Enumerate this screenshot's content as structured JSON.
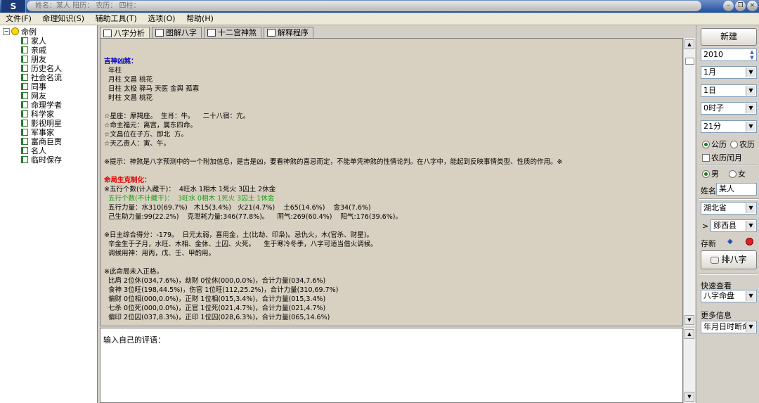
{
  "window": {
    "title": "姓名：某人   阳历：  农历：  四柱：",
    "icon_label": "S"
  },
  "menu": [
    "文件(F)",
    "命理知识(S)",
    "辅助工具(T)",
    "选项(O)",
    "帮助(H)"
  ],
  "tree": {
    "root_label": "命例",
    "items": [
      "家人",
      "亲戚",
      "朋友",
      "历史名人",
      "社会名流",
      "同事",
      "网友",
      "命理学者",
      "科学家",
      "影视明星",
      "军事家",
      "富商巨贾",
      "名人",
      "临时保存"
    ]
  },
  "tabs": [
    "八字分析",
    "图解八字",
    "十二宫神煞",
    "解释程序"
  ],
  "analysis": {
    "shensha_title": "吉神凶煞：",
    "shensha_lines": [
      "  年柱",
      "  月柱 文昌 桃花",
      "  日柱 太极 驿马 天医 金舆 孤寡",
      "  时柱 文昌 桃花"
    ],
    "star_lines": [
      "☆星座：摩羯座。  生肖：牛。    二十八宿：亢。",
      "☆命主福元：离宫，属东四命。",
      "☆文昌位在子方、即北  方。",
      "☆天乙贵人：寅、午。"
    ],
    "note": "※提示：神煞是八字预测中的一个附加信息，是吉是凶，要看神煞的喜忌而定，不能单凭神煞的性情论判。在八字中，能起到反映事情类型、性质的作用。※",
    "wuxing_title": "命局生克制化：",
    "wuxing_line1": "※五行个数(计入藏干)：  4旺水 1相木 1死火 3囚土 2休金",
    "wuxing_line2": "  五行个数(不计藏干)：  3旺水 0相木 1死火 3囚土 1休金",
    "wuxing_lines": [
      "  五行力量：水310(69.7%)   木15(3.4%)   火21(4.7%)    土65(14.6%)    金34(7.6%)",
      "  己生助力量:99(22.2%)    克泄耗力量:346(77.8%)。    阴气:269(60.4%)    阳气:176(39.6%)。"
    ],
    "score_lines": [
      "※日主综合得分：-179。  日元太弱，喜用金，土(比劫、印枭)。忌仇火，木(官杀、财星)。",
      "  辛金生于子月，水旺、木相、金休、土囚、火死。    生于寒冷冬季，八字可适当借火调候。",
      "  调候用神：用丙，戊、壬、甲酌用。"
    ],
    "pattern_lines": [
      "※此命局未入正格。",
      "  比肩 2位休(034,7.6%)，劫财 0位休(000,0.0%)，合计力量(034,7.6%)",
      "  食神 3位旺(198,44.5%)，伤官 1位旺(112,25.2%)，合计力量(310,69.7%)",
      "  偏财 0位相(000,0.0%)，正财 1位相(015,3.4%)，合计力量(015,3.4%)",
      "  七杀 0位死(000,0.0%)，正官 1位死(021,4.7%)，合计力量(021,4.7%)",
      "  偏印 2位囚(037,8.3%)，正印 1位囚(028,6.3%)，合计力量(065,14.6%)"
    ]
  },
  "comment": {
    "prompt": "输入自己的评语："
  },
  "right_panel": {
    "new_button": "新建",
    "year": "2010",
    "month": "1月",
    "day": "1日",
    "hour": "0时子",
    "minute": "21分",
    "calendar_solar": "公历",
    "calendar_lunar": "农历",
    "calendar_selected": "公历",
    "leap_month": "农历闰月",
    "leap_checked": false,
    "gender_male": "男",
    "gender_female": "女",
    "gender_selected": "男",
    "name_label": "姓名",
    "name_value": "某人",
    "province": "湖北省",
    "county_prefix": ">",
    "county": "郧西县",
    "save_label": "存新",
    "paipan_button": "排八字",
    "quick_view_label": "快速查看",
    "quick_view_value": "八字命盘",
    "more_info_label": "更多信息",
    "more_info_value": "年月日时断命"
  },
  "colors": {
    "blue_heading": "#0000c0",
    "red_heading": "#e00000",
    "green_text": "#18a018",
    "content_bg": "#d8d0c0"
  }
}
